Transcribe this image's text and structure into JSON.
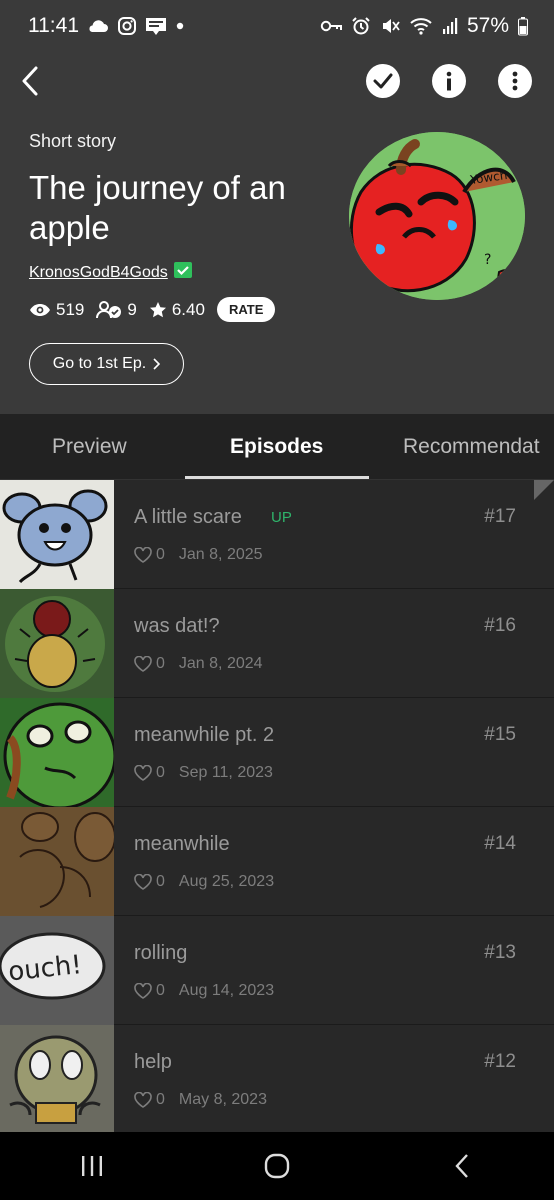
{
  "status_bar": {
    "time": "11:41",
    "battery_percent": "57%",
    "battery_level": 0.57,
    "left_icons": [
      "cloud-icon",
      "instagram-icon",
      "webtoon-icon",
      "dot-icon"
    ],
    "right_icons": [
      "key-icon",
      "alarm-icon",
      "mute-icon",
      "wifi-icon",
      "signal-icon",
      "battery-icon"
    ]
  },
  "header": {
    "genre": "Short story",
    "title": "The journey of an apple",
    "author": "KronosGodB4Gods",
    "views": "519",
    "subscribers": "9",
    "rating": "6.40",
    "rate_label": "RATE",
    "first_ep_label": "Go to 1st Ep.",
    "colors": {
      "background": "#3a3a3a",
      "verified": "#2fc05c"
    }
  },
  "tabs": [
    {
      "label": "Preview"
    },
    {
      "label": "Episodes",
      "active": true
    },
    {
      "label": "Recommendat"
    }
  ],
  "episodes": [
    {
      "title": "A little scare",
      "badge": "UP",
      "number": "#17",
      "likes": "0",
      "date": "Jan 8, 2025"
    },
    {
      "title": "was dat!?",
      "number": "#16",
      "likes": "0",
      "date": "Jan 8, 2024"
    },
    {
      "title": "meanwhile pt. 2",
      "number": "#15",
      "likes": "0",
      "date": "Sep 11, 2023"
    },
    {
      "title": "meanwhile",
      "number": "#14",
      "likes": "0",
      "date": "Aug 25, 2023"
    },
    {
      "title": "rolling",
      "number": "#13",
      "likes": "0",
      "date": "Aug 14, 2023"
    },
    {
      "title": "help",
      "number": "#12",
      "likes": "0",
      "date": "May 8, 2023"
    }
  ],
  "thumbnail_text": {
    "ouch": "ouch!",
    "cover_scribble": "Yowch"
  }
}
